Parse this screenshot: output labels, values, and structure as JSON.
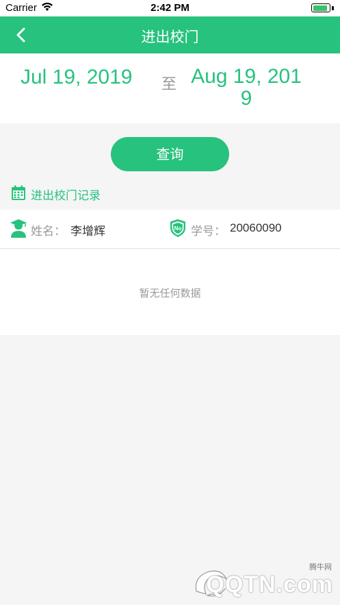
{
  "status_bar": {
    "carrier": "Carrier",
    "time": "2:42 PM",
    "battery_level": 0.9
  },
  "nav": {
    "title": "进出校门",
    "back_icon": "chevron-left-icon"
  },
  "date_range": {
    "from": "Jul 19, 2019",
    "separator": "至",
    "to": "Aug 19, 2019"
  },
  "query_button": "查询",
  "section": {
    "icon": "calendar-icon",
    "title": "进出校门记录"
  },
  "student": {
    "name_icon": "student-icon",
    "name_label": "姓名：",
    "name": "李增辉",
    "id_icon": "no-badge-icon",
    "id_label": "学号：",
    "id": "20060090"
  },
  "empty_message": "暂无任何数据",
  "watermark": {
    "site": "腾牛网",
    "brand": "QQTN.com"
  },
  "colors": {
    "accent": "#27c27e",
    "background": "#f5f5f5",
    "muted": "#999999"
  }
}
